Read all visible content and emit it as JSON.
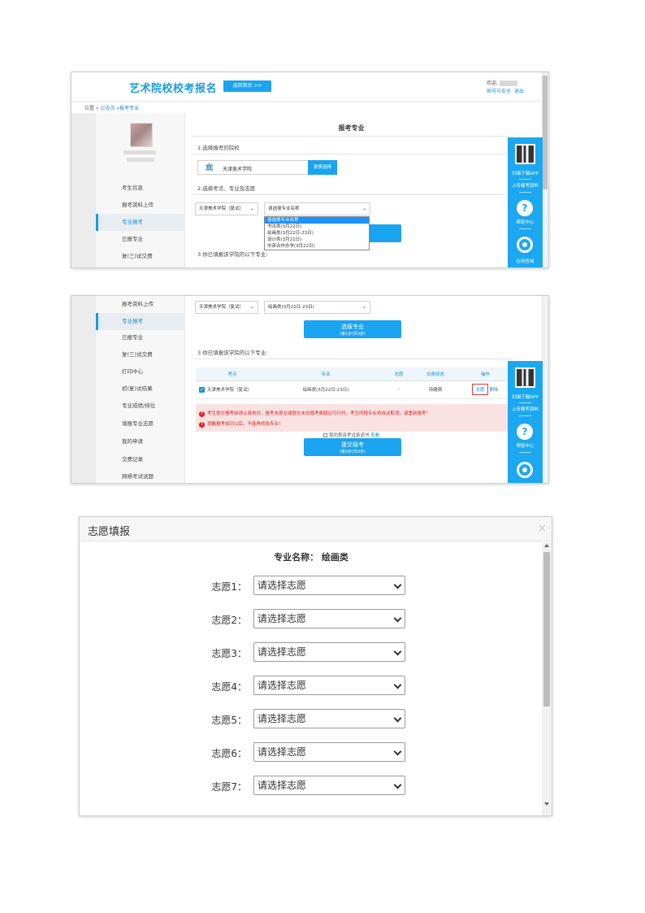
{
  "shot1": {
    "logo": "艺术院校校考报名",
    "home_button": "返回首页 >>",
    "welcome": "欢迎,",
    "links": [
      "账号与安全",
      "退出"
    ],
    "breadcrumb": {
      "prefix": "位置 »",
      "link1": "公告页",
      "sep": " »",
      "link2": "报考专业"
    },
    "sidebar": [
      "考生信息",
      "报考资料上传",
      "专业报考",
      "已报专业",
      "复(三)试交费"
    ],
    "title": "报考专业",
    "step1": "1.选择报考的院校",
    "school_name": "天津美术学院",
    "change_button": "更换选择",
    "step2": "2.选择考点、专业及志愿",
    "exam_site_select": "天津美术学院（复试）",
    "major_select_placeholder": "请选择专业名称",
    "major_options": [
      "请选择专业名称",
      "书法类(3月22日)",
      "绘画类(3月22日-23日)",
      "设计类(3月21日)",
      "中英合作办学(3月22日)"
    ],
    "step3": "3.你已填报该学院的以下专业:"
  },
  "float": {
    "scan_download": "扫描下载APP",
    "upload": "上传报考资料",
    "help": "帮助中心",
    "online": "在线咨询",
    "help_glyph": "?"
  },
  "shot2": {
    "sidebar": [
      "报考资料上传",
      "专业报考",
      "已报专业",
      "复(三)试交费",
      "打印中心",
      "初(复)试结果",
      "专业成绩/排位",
      "填报专业志愿",
      "我的申请",
      "交费记录",
      "网络考试试题"
    ],
    "exam_site_select": "天津美术学院（复试）",
    "major_select": "绘画类(3月22日-23日)",
    "select_button": {
      "title": "选报专业",
      "sub": "(第1步/共3步)"
    },
    "step3": "3.你已填报该学院的以下专业:",
    "table_headers": [
      "考点",
      "专业",
      "志愿",
      "交费状态",
      "操作"
    ],
    "row": {
      "site": "天津美术学院（复试）",
      "major": "绘画类(3月22日-23日)",
      "wish": "-",
      "fee": "待缴费",
      "op_wish": "志愿",
      "op_delete": "删除"
    },
    "warn1": "考生提交报考前请认真核对，报考未提交或提交未交报考费超过可行时，考生所报专业将自动取消，请重新报考！",
    "warn2": "提醒报考成功以后，不能再修改专业！",
    "agree_text": "我同意该考试承诺书",
    "agree_link": "查看",
    "submit_button": {
      "title": "提交报考",
      "sub": "(第2步/共3步)"
    }
  },
  "dialog": {
    "title": "志愿填报",
    "close": "×",
    "major_label": "专业名称：",
    "major_value": "绘画类",
    "placeholder": "请选择志愿",
    "wishes": [
      "志愿1：",
      "志愿2：",
      "志愿3：",
      "志愿4：",
      "志愿5：",
      "志愿6：",
      "志愿7："
    ]
  }
}
